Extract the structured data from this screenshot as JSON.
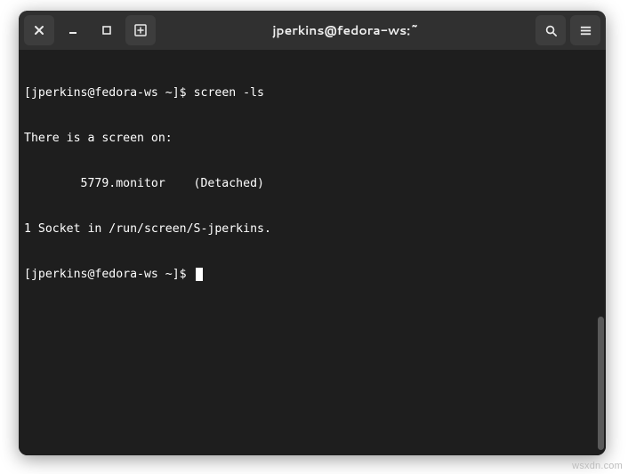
{
  "window": {
    "title": "jperkins@fedora-ws:~"
  },
  "terminal": {
    "lines": [
      {
        "prompt": "[jperkins@fedora-ws ~]$ ",
        "cmd": "screen -ls"
      },
      {
        "text": "There is a screen on:"
      },
      {
        "text": "        5779.monitor    (Detached)"
      },
      {
        "text": "1 Socket in /run/screen/S-jperkins."
      },
      {
        "prompt": "[jperkins@fedora-ws ~]$ ",
        "cmd": "",
        "cursor": true
      }
    ]
  },
  "watermark": "wsxdn.com"
}
